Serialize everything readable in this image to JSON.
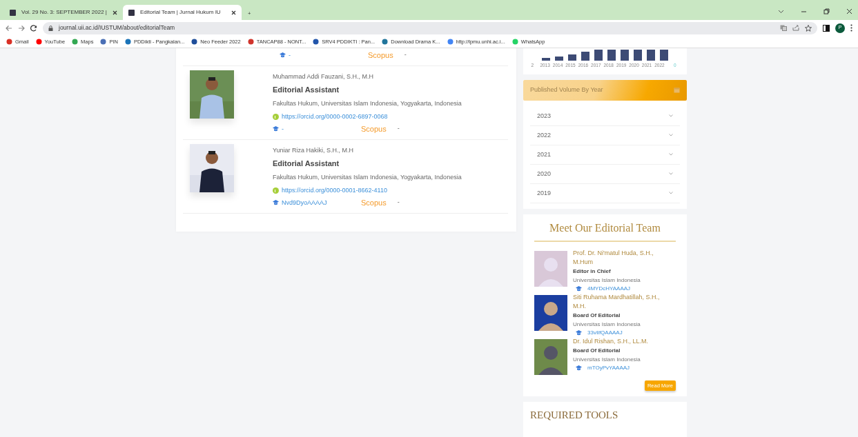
{
  "browser": {
    "tabs": [
      {
        "title": "Vol. 29 No. 3: SEPTEMBER 2022 |",
        "selected": false
      },
      {
        "title": "Editorial Team | Jurnal Hukum IU",
        "selected": true
      }
    ],
    "new_tab": "+",
    "address": "journal.uii.ac.id/IUSTUM/about/editorialTeam",
    "profile": "P",
    "bookmarks": [
      {
        "label": "Gmail",
        "color": "#d93025"
      },
      {
        "label": "YouTube",
        "color": "#ff0000"
      },
      {
        "label": "Maps",
        "color": "#34a853"
      },
      {
        "label": "PIN",
        "color": "#4a6fb5"
      },
      {
        "label": "PDDikti - Pangkalan...",
        "color": "#1a73b8"
      },
      {
        "label": "Neo Feeder 2022",
        "color": "#1f4e9a"
      },
      {
        "label": "TANCAP88 - NONT...",
        "color": "#d0342c"
      },
      {
        "label": "SRV4 PDDIKTI : Pan...",
        "color": "#2255aa"
      },
      {
        "label": "Download Drama K...",
        "color": "#21759b"
      },
      {
        "label": "http://lpmu.unhi.ac.i...",
        "color": "#4285f4"
      },
      {
        "label": "WhatsApp",
        "color": "#25d366"
      }
    ]
  },
  "members": [
    {
      "kind": "partial",
      "scholar": "-",
      "scopus": "Scopus",
      "scopus_value": "-"
    },
    {
      "kind": "full",
      "name": "Muhammad Addi Fauzani, S.H., M.H",
      "role": "Editorial Assistant",
      "affiliation": "Fakultas Hukum, Universitas Islam Indonesia, Yogyakarta, Indonesia",
      "orcid": "https://orcid.org/0000-0002-6897-0068",
      "scholar": "-",
      "scopus": "Scopus",
      "scopus_value": "-"
    },
    {
      "kind": "full",
      "name": "Yuniar Riza Hakiki, S.H., M.H",
      "role": "Editorial Assistant",
      "affiliation": "Fakultas Hukum, Universitas Islam Indonesia, Yogyakarta, Indonesia",
      "orcid": "https://orcid.org/0000-0001-8662-4110",
      "scholar": "Nvd9DyoAAAAJ",
      "scopus": "Scopus",
      "scopus_value": "-"
    }
  ],
  "chart": {
    "labels": [
      "2",
      "2013",
      "2014",
      "2015",
      "2016",
      "2017",
      "2018",
      "2019",
      "2020",
      "2021",
      "2022"
    ],
    "side_label": "0"
  },
  "volumes": {
    "title": "Published Volume By Year",
    "years": [
      {
        "label": "2023",
        "expanded": false
      },
      {
        "label": "2022",
        "expanded": false
      },
      {
        "label": "2021",
        "expanded": false
      },
      {
        "label": "2020",
        "expanded": false
      },
      {
        "label": "2019",
        "expanded": false
      }
    ]
  },
  "team": {
    "title": "Meet Our Editorial Team",
    "members": [
      {
        "name": "Prof. Dr. Ni'matul Huda, S.H., M.Hum",
        "role": "Editor in Chief",
        "affiliation": "Universitas Islam Indonesia",
        "scholar": "4MYDcHYAAAAJ"
      },
      {
        "name": "Siti Ruhama Mardhatillah, S.H., M.H.",
        "role": "Board Of Editorial",
        "affiliation": "Universitas Islam Indonesia",
        "scholar": "33vIifQAAAAJ"
      },
      {
        "name": "Dr. Idul Rishan, S.H., LL.M.",
        "role": "Board Of Editorial",
        "affiliation": "Universitas Islam Indonesia",
        "scholar": "mTOyPvYAAAAJ"
      }
    ],
    "button": "Read More"
  },
  "tools": {
    "title": "REQUIRED TOOLS"
  }
}
